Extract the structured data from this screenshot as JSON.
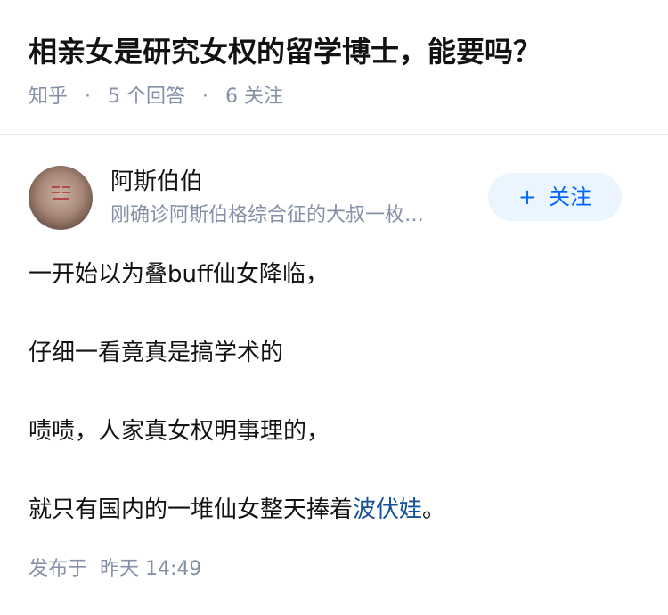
{
  "question": {
    "title": "相亲女是研究女权的留学博士，能要吗？",
    "source": "知乎",
    "separator": "·",
    "answers_count": "5 个回答",
    "followers_count": "6 关注"
  },
  "author": {
    "name": "阿斯伯伯",
    "bio": "刚确诊阿斯伯格综合征的大叔一枚…",
    "follow_plus": "+",
    "follow_label": "关注"
  },
  "answer": {
    "paragraphs": [
      "一开始以为叠buff仙女降临，",
      "仔细一看竟真是搞学术的",
      "啧啧，人家真女权明事理的，"
    ],
    "last_paragraph_prefix": "就只有国内的一堆仙女整天捧着",
    "last_paragraph_link": "波伏娃",
    "last_paragraph_suffix": "。"
  },
  "meta": {
    "published_label": "发布于",
    "published_time": "昨天 14:49"
  },
  "colors": {
    "meta_gray": "#8590a6",
    "follow_blue": "#0066ff",
    "follow_bg": "#ebf5ff",
    "link_blue": "#175199"
  }
}
